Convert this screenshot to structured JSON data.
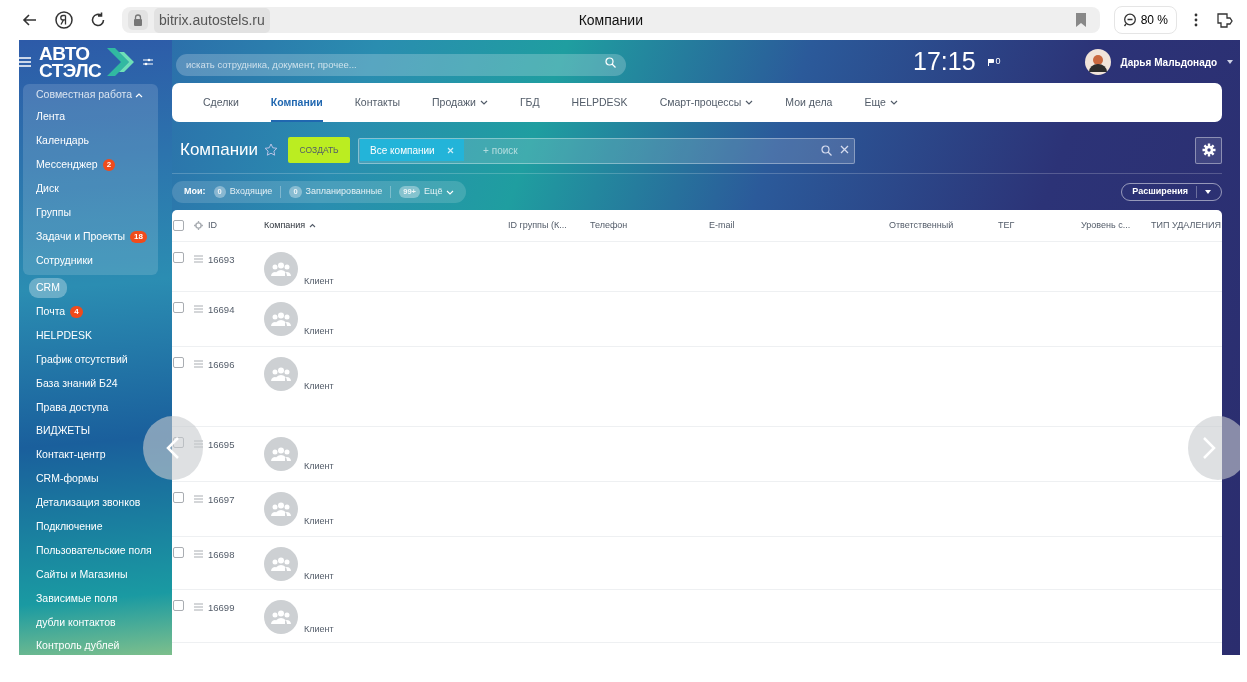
{
  "browser": {
    "url": "bitrix.autostels.ru",
    "title": "Компании",
    "zoom": "80 %"
  },
  "logo": {
    "line1": "АВТО",
    "line2": "СТЭЛС"
  },
  "header": {
    "search_placeholder": "искать сотрудника, документ, прочее...",
    "clock": "17:15",
    "flag_count": "0",
    "user_name": "Дарья Мальдонадо"
  },
  "sidebar": {
    "section_label": "Совместная работа",
    "section_expanded": true,
    "section_items": [
      {
        "label": "Лента"
      },
      {
        "label": "Календарь"
      },
      {
        "label": "Мессенджер",
        "counter": "2"
      },
      {
        "label": "Диск"
      },
      {
        "label": "Группы"
      },
      {
        "label": "Задачи и Проекты",
        "counter": "18"
      },
      {
        "label": "Сотрудники"
      }
    ],
    "items": [
      {
        "label": "CRM",
        "selected": true
      },
      {
        "label": "Почта",
        "selected": false,
        "counter": "4"
      },
      {
        "label": "HELPDESK",
        "selected": false
      },
      {
        "label": "График отсутствий",
        "selected": false
      },
      {
        "label": "База знаний Б24",
        "selected": false
      },
      {
        "label": "Права доступа",
        "selected": false
      },
      {
        "label": "ВИДЖЕТЫ",
        "selected": false
      },
      {
        "label": "Контакт-центр",
        "selected": false
      },
      {
        "label": "CRM-формы",
        "selected": false
      },
      {
        "label": "Детализация звонков",
        "selected": false
      },
      {
        "label": "Подключение",
        "selected": false
      },
      {
        "label": "Пользовательские поля",
        "selected": false
      },
      {
        "label": "Сайты и Магазины",
        "selected": false
      },
      {
        "label": "Зависимые поля",
        "selected": false
      },
      {
        "label": "дубли контактов",
        "selected": false
      },
      {
        "label": "Контроль дублей",
        "selected": false
      }
    ]
  },
  "tabs": [
    {
      "label": "Сделки",
      "selected": false,
      "dropdown": false
    },
    {
      "label": "Компании",
      "selected": true,
      "dropdown": false
    },
    {
      "label": "Контакты",
      "selected": false,
      "dropdown": false
    },
    {
      "label": "Продажи",
      "selected": false,
      "dropdown": true
    },
    {
      "label": "ГБД",
      "selected": false,
      "dropdown": false
    },
    {
      "label": "HELPDESK",
      "selected": false,
      "dropdown": false
    },
    {
      "label": "Смарт-процессы",
      "selected": false,
      "dropdown": true
    },
    {
      "label": "Мои дела",
      "selected": false,
      "dropdown": false
    },
    {
      "label": "Еще",
      "selected": false,
      "dropdown": true
    }
  ],
  "page": {
    "title": "Компании",
    "create_button": "СОЗДАТЬ",
    "filter_tag": "Все компании",
    "search_placeholder": "+ поиск"
  },
  "counters": {
    "label": "Мои:",
    "items": [
      {
        "count": "0",
        "label": "Входящие",
        "dropdown": false
      },
      {
        "count": "0",
        "label": "Запланированные",
        "dropdown": false
      },
      {
        "count": "99+",
        "label": "Ещё",
        "dropdown": true
      }
    ]
  },
  "extensions_button": "Расширения",
  "table": {
    "all_checked": false,
    "columns": [
      {
        "label": "ID",
        "sorted": false
      },
      {
        "label": "Компания",
        "sorted": true
      },
      {
        "label": "ID группы (К...",
        "sorted": false
      },
      {
        "label": "Телефон",
        "sorted": false
      },
      {
        "label": "E-mail",
        "sorted": false
      },
      {
        "label": "Ответственный",
        "sorted": false
      },
      {
        "label": "ТЕГ",
        "sorted": false
      },
      {
        "label": "Уровень с...",
        "sorted": false
      },
      {
        "label": "ТИП УДАЛЕНИЯ",
        "sorted": false
      }
    ],
    "rows": [
      {
        "id": "16693",
        "type": "Клиент",
        "checked": false
      },
      {
        "id": "16694",
        "type": "Клиент",
        "checked": false
      },
      {
        "id": "16696",
        "type": "Клиент",
        "checked": false
      },
      {
        "id": "16695",
        "type": "Клиент",
        "checked": false
      },
      {
        "id": "16697",
        "type": "Клиент",
        "checked": false
      },
      {
        "id": "16698",
        "type": "Клиент",
        "checked": false
      },
      {
        "id": "16699",
        "type": "Клиент",
        "checked": false
      }
    ]
  }
}
